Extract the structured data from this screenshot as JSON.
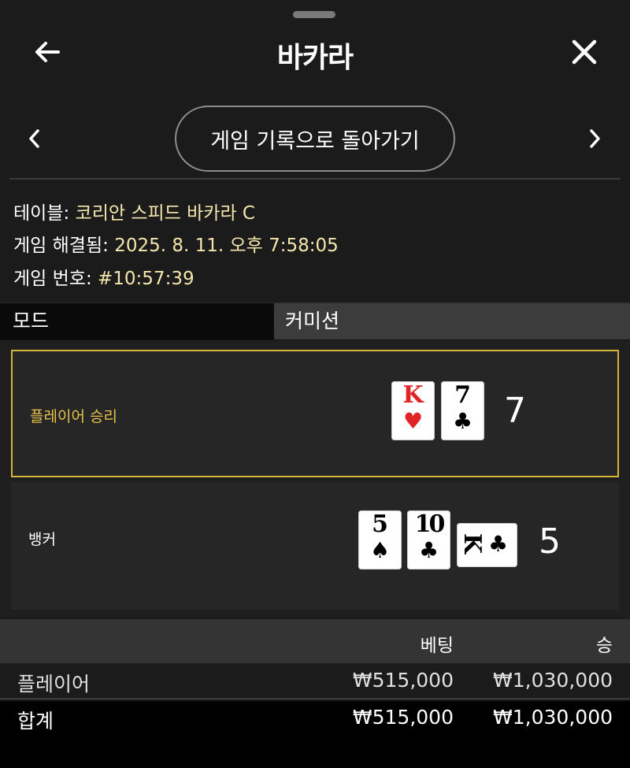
{
  "header": {
    "title": "바카라",
    "back_icon": "arrow-left-icon",
    "close_icon": "close-icon"
  },
  "nav": {
    "return_label": "게임 기록으로 돌아가기",
    "prev_icon": "chevron-left-icon",
    "next_icon": "chevron-right-icon"
  },
  "info": {
    "table_label": "테이블:",
    "table_value": "코리안 스피드 바카라 C",
    "resolved_label": "게임 해결됨:",
    "resolved_value": "2025. 8. 11. 오후 7:58:05",
    "number_label": "게임 번호:",
    "number_value": "#10:57:39"
  },
  "mode": {
    "mode_label": "모드",
    "mode_value": "커미션"
  },
  "result": {
    "player": {
      "label": "플레이어 승리",
      "score": "7",
      "cards": [
        {
          "rank": "K",
          "suit": "♥"
        },
        {
          "rank": "7",
          "suit": "♣"
        }
      ]
    },
    "banker": {
      "label": "뱅커",
      "score": "5",
      "cards": [
        {
          "rank": "5",
          "suit": "♠"
        },
        {
          "rank": "10",
          "suit": "♣"
        },
        {
          "rank": "K",
          "suit": "♣"
        }
      ]
    }
  },
  "summary": {
    "bet_header": "베팅",
    "win_header": "승",
    "rows": [
      {
        "label": "플레이어",
        "bet": "₩515,000",
        "win": "₩1,030,000"
      },
      {
        "label": "합계",
        "bet": "₩515,000",
        "win": "₩1,030,000"
      }
    ]
  },
  "colors": {
    "accent": "#d9b43a",
    "info_value": "#f4e7ad",
    "card_red": "#e02424"
  }
}
